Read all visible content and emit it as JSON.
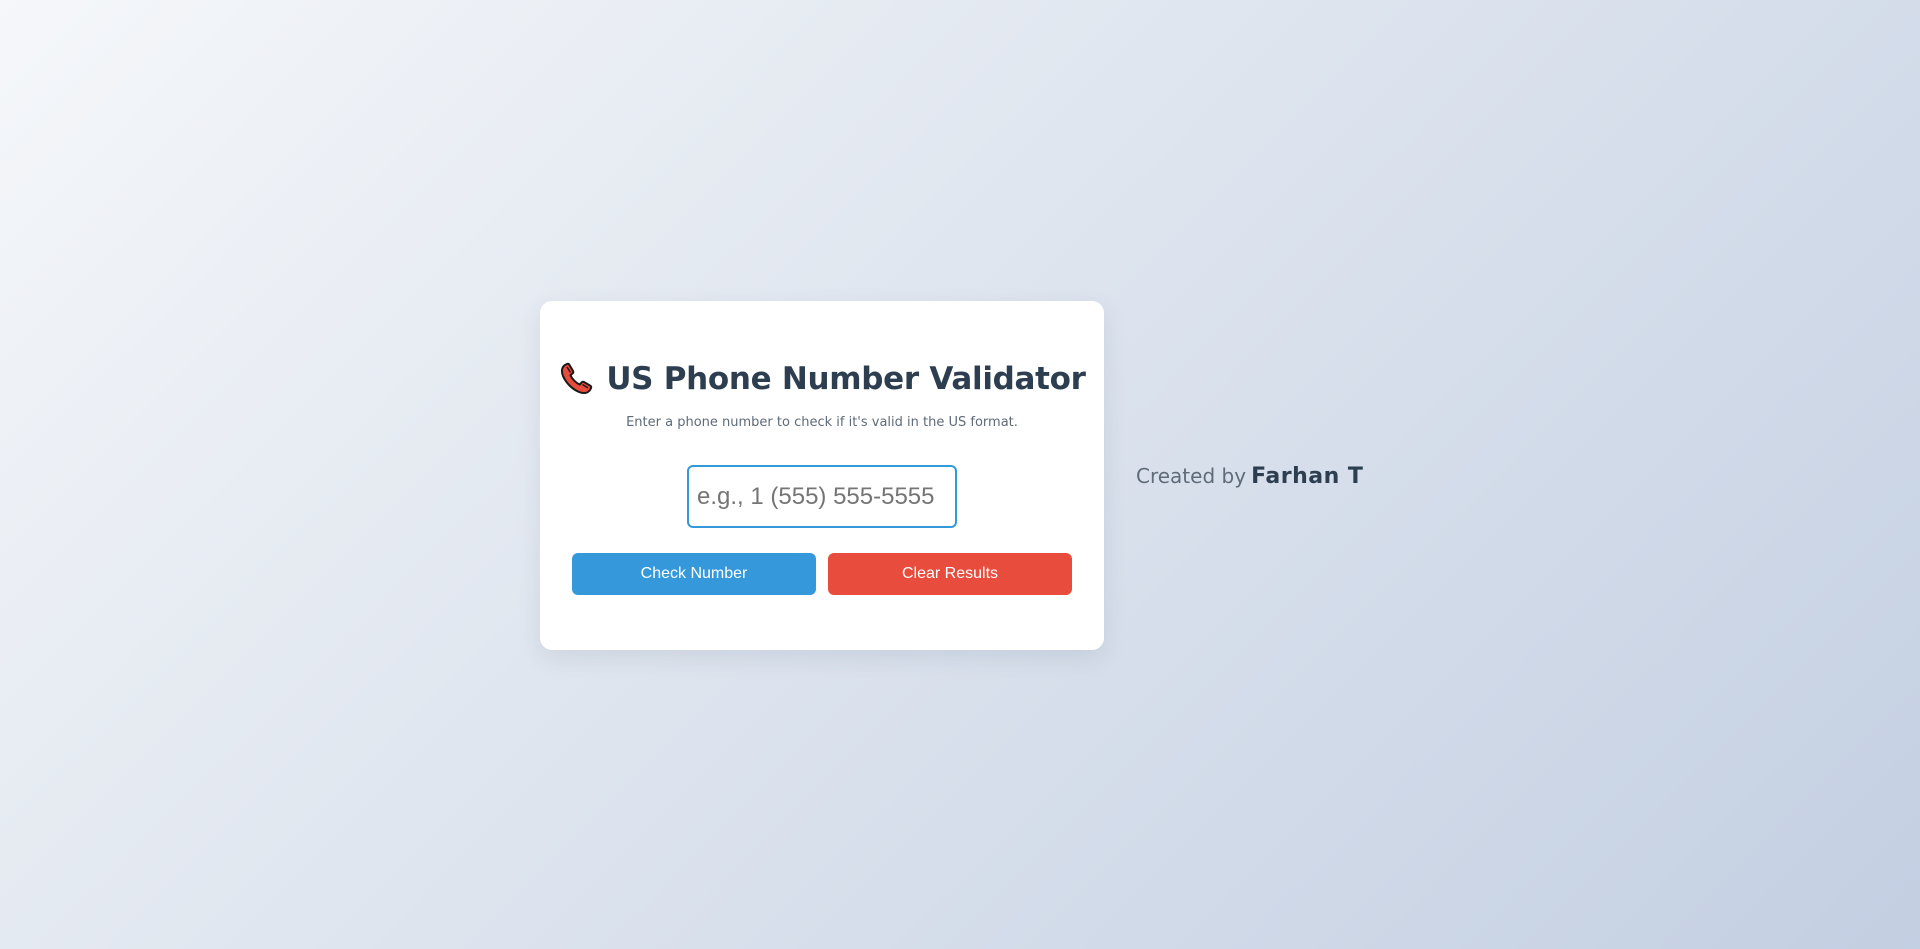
{
  "app": {
    "title": "US Phone Number Validator",
    "subtitle": "Enter a phone number to check if it's valid in the US format.",
    "title_icon": "telephone-receiver-icon"
  },
  "form": {
    "phone_input": {
      "placeholder": "e.g., 1 (555) 555-5555",
      "value": ""
    },
    "check_button_label": "Check Number",
    "clear_button_label": "Clear Results"
  },
  "footer": {
    "credit_prefix": "Created by",
    "credit_author": "Farhan T"
  },
  "colors": {
    "primary": "#3498db",
    "danger": "#e74c3c",
    "heading": "#2c3e50",
    "muted": "#5f6b78"
  }
}
